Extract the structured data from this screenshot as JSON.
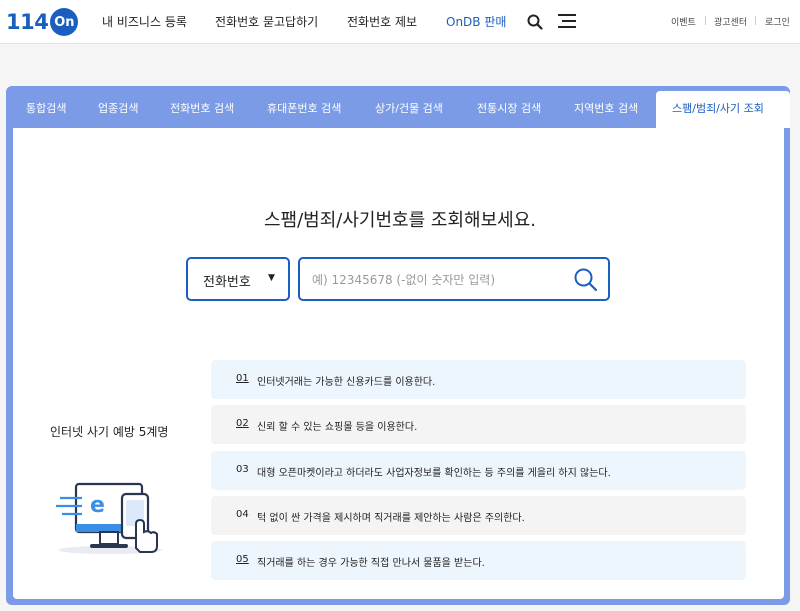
{
  "header": {
    "logo_num": "114",
    "logo_on": "On",
    "nav": [
      "내 비즈니스 등록",
      "전화번호 묻고답하기",
      "전화번호 제보",
      "OnDB 판매"
    ],
    "util": [
      "이벤트",
      "광고센터",
      "로그인"
    ]
  },
  "tabs": [
    "통합검색",
    "업종검색",
    "전화번호 검색",
    "휴대폰번호 검색",
    "상가/건물 검색",
    "전통시장 검색",
    "지역번호 검색",
    "스팸/범죄/사기 조회"
  ],
  "active_tab": "스팸/범죄/사기 조회",
  "main": {
    "headline": "스팸/범죄/사기번호를 조회해보세요.",
    "select_value": "전화번호",
    "search_placeholder": "예) 12345678 (-없이 숫자만 입력)",
    "side_title": "인터넷 사기 예방 5계명"
  },
  "tips": [
    {
      "num": "01",
      "text": "인터넷거래는 가능한 신용카드를 이용한다."
    },
    {
      "num": "02",
      "text": "신뢰 할 수 있는 쇼핑몰 등을 이용한다."
    },
    {
      "num": "03",
      "text": "대형 오픈마켓이라고 하더라도 사업자정보를 확인하는 등 주의를 게을리 하지 않는다."
    },
    {
      "num": "04",
      "text": "턱 없이 싼 가격을 제시하며 직거래를 제안하는 사람은 주의한다."
    },
    {
      "num": "05",
      "text": "직거래를 하는 경우 가능한 직접 만나서 물품을 받는다."
    }
  ],
  "colors": {
    "brand": "#1a5fc0",
    "tab_bar": "#7b9be6",
    "tip_blue": "#eef6fd",
    "tip_gray": "#f4f4f4"
  },
  "icons": [
    "search-icon",
    "menu-icon",
    "caret-down-icon",
    "online-shopping-illustration"
  ]
}
